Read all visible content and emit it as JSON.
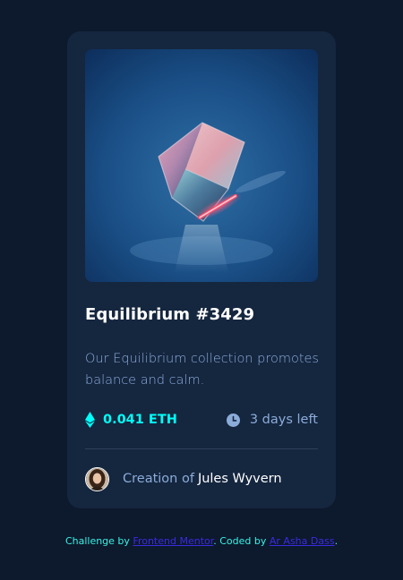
{
  "card": {
    "title": "Equilibrium #3429",
    "description": "Our Equilibrium collection promotes balance and calm.",
    "price": "0.041 ETH",
    "time_left": "3 days left",
    "creator_prefix": "Creation of",
    "creator_name": "Jules Wyvern",
    "image_icon": "equilibrium-cube-image",
    "price_icon": "ethereum-icon",
    "time_icon": "clock-icon"
  },
  "attribution": {
    "prefix": "Challenge by",
    "link1": "Frontend Mentor",
    "middle": ". Coded by",
    "link2": "Ar Asha Dass",
    "suffix": "."
  },
  "colors": {
    "background": "#0d192c",
    "card": "#15263f",
    "accent_cyan": "#00fff8",
    "soft_blue": "#8bacd9",
    "divider": "#2e405a",
    "white": "#ffffff",
    "link": "#3b2be0"
  }
}
